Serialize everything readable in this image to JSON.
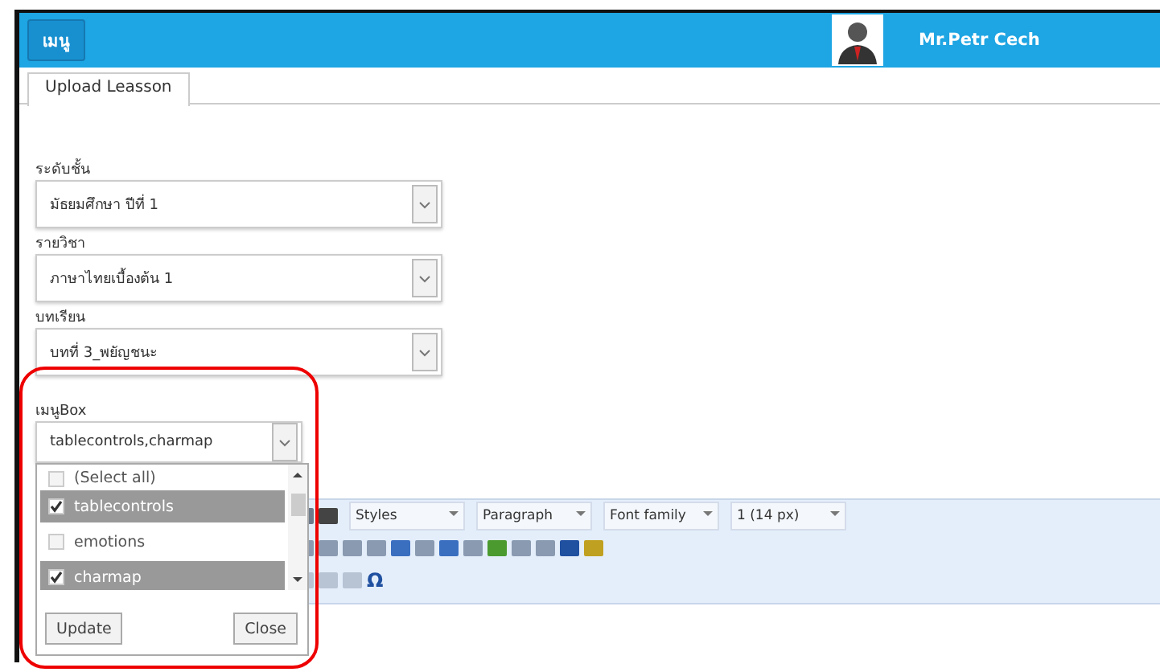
{
  "header": {
    "menu_button": "เมนู",
    "user_name": "Mr.Petr Cech"
  },
  "tabs": [
    {
      "label": "Upload Leasson",
      "selected": true
    }
  ],
  "fields": [
    {
      "label": "ระดับชั้น",
      "value": "มัธยมศึกษา ปีที่ 1"
    },
    {
      "label": "รายวิชา",
      "value": "ภาษาไทยเบื้องต้น 1"
    },
    {
      "label": "บทเรียน",
      "value": "บทที่ 3_พยัญชนะ"
    }
  ],
  "menu_box": {
    "label": "เมนูBox",
    "value": "tablecontrols,charmap",
    "expanded": true,
    "options": [
      {
        "label": "(Select all)",
        "checked": false
      },
      {
        "label": "tablecontrols",
        "checked": true
      },
      {
        "label": "emotions",
        "checked": false
      },
      {
        "label": "charmap",
        "checked": true
      }
    ],
    "buttons": [
      "Update",
      "Close"
    ]
  },
  "editor": {
    "dropdowns": [
      "Styles",
      "Paragraph",
      "Font family",
      "1 (14 px)"
    ],
    "special_char_button": "Ω"
  }
}
